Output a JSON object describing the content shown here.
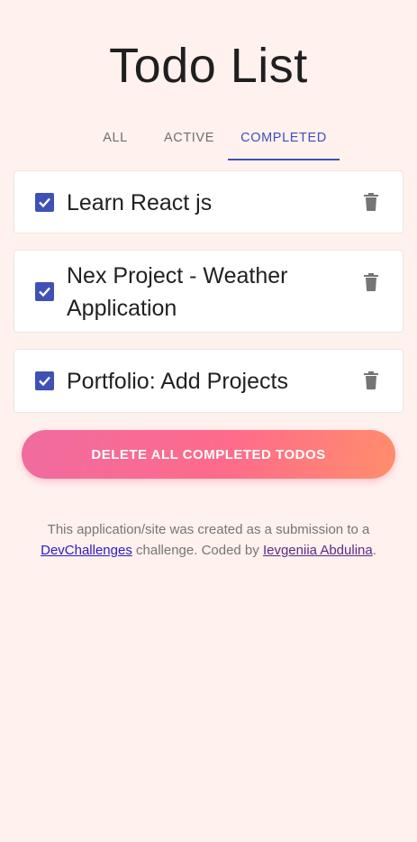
{
  "header": {
    "title": "Todo List"
  },
  "tabs": [
    {
      "label": "All",
      "selected": false
    },
    {
      "label": "Active",
      "selected": false
    },
    {
      "label": "Completed",
      "selected": true
    }
  ],
  "todos": [
    {
      "text": "Learn React js",
      "completed": true
    },
    {
      "text": "Nex Project - Weather Application",
      "completed": true
    },
    {
      "text": "Portfolio: Add Projects",
      "completed": true
    }
  ],
  "actions": {
    "delete_all_label": "DELETE ALL COMPLETED TODOS"
  },
  "footer": {
    "text_before": "This application/site was created as a submission to a ",
    "link1_text": "DevChallenges",
    "text_middle": " challenge. Coded by ",
    "link2_text": "Ievgeniia Abdulina",
    "text_after": "."
  },
  "colors": {
    "background": "#fff1ee",
    "accent": "#3f51b5",
    "button_gradient_start": "#f06ba0",
    "button_gradient_end": "#ff8e6b"
  },
  "icons": {
    "checkbox": "checkbox-checked-icon",
    "delete": "trash-icon"
  }
}
